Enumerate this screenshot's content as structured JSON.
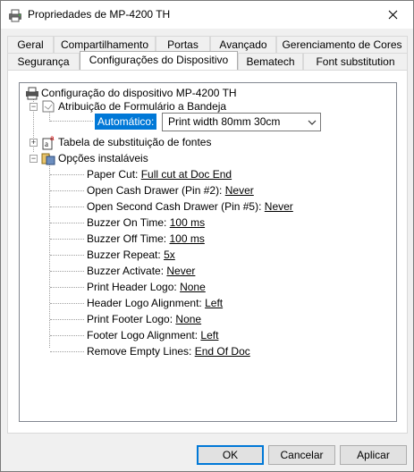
{
  "window": {
    "title": "Propriedades de MP-4200 TH"
  },
  "tabs_row1": [
    {
      "label": "Geral"
    },
    {
      "label": "Compartilhamento"
    },
    {
      "label": "Portas"
    },
    {
      "label": "Avançado"
    },
    {
      "label": "Gerenciamento de Cores"
    }
  ],
  "tabs_row2": [
    {
      "label": "Segurança"
    },
    {
      "label": "Configurações do Dispositivo"
    },
    {
      "label": "Bematech"
    },
    {
      "label": "Font substitution"
    }
  ],
  "tree": {
    "root": "Configuração do dispositivo MP-4200 TH",
    "form_tray": "Atribuição de Formulário a Bandeja",
    "auto_label": "Automático:",
    "auto_value": "Print width 80mm 30cm",
    "font_table": "Tabela de substituição de fontes",
    "options": "Opções instaláveis",
    "items": [
      {
        "label": "Paper Cut:",
        "value": "Full cut at Doc End"
      },
      {
        "label": "Open Cash Drawer (Pin #2):",
        "value": "Never"
      },
      {
        "label": "Open Second Cash Drawer (Pin #5):",
        "value": "Never"
      },
      {
        "label": "Buzzer On Time:",
        "value": "100 ms"
      },
      {
        "label": "Buzzer Off Time:",
        "value": "100 ms"
      },
      {
        "label": "Buzzer Repeat:",
        "value": "5x"
      },
      {
        "label": "Buzzer Activate:",
        "value": "Never"
      },
      {
        "label": "Print Header Logo:",
        "value": "None"
      },
      {
        "label": "Header Logo Alignment:",
        "value": "Left"
      },
      {
        "label": "Print Footer Logo:",
        "value": "None"
      },
      {
        "label": "Footer Logo Alignment:",
        "value": "Left"
      },
      {
        "label": "Remove Empty Lines:",
        "value": "End Of Doc"
      }
    ]
  },
  "buttons": {
    "ok": "OK",
    "cancel": "Cancelar",
    "apply": "Aplicar"
  },
  "colors": {
    "selection": "#0078d7",
    "panel": "#ffffff",
    "chrome": "#f0f0f0"
  },
  "icons": [
    "printer-icon",
    "close-icon",
    "form-icon",
    "font-table-icon",
    "options-icon",
    "chevron-down-icon"
  ]
}
